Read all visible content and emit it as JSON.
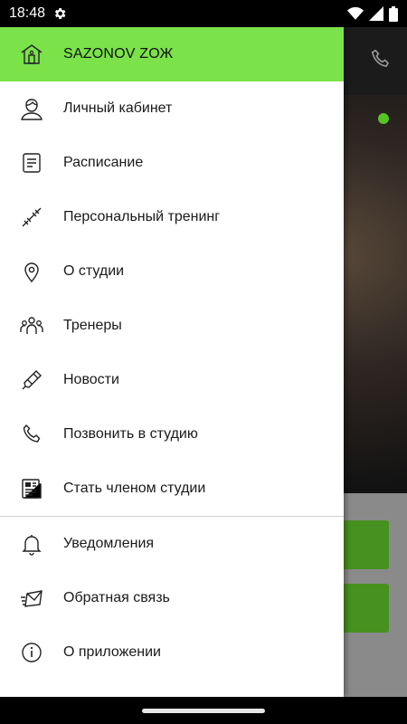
{
  "status_bar": {
    "time": "18:48"
  },
  "drawer": {
    "title": "SAZONOV ZОЖ",
    "header_color": "#7be24a",
    "items_top": [
      {
        "label": "Личный кабинет",
        "icon": "user-icon"
      },
      {
        "label": "Расписание",
        "icon": "schedule-icon"
      },
      {
        "label": "Персональный тренинг",
        "icon": "dumbbell-icon"
      },
      {
        "label": "О студии",
        "icon": "location-pin-icon"
      },
      {
        "label": "Тренеры",
        "icon": "trainers-icon"
      },
      {
        "label": "Новости",
        "icon": "news-icon"
      },
      {
        "label": "Позвонить в студию",
        "icon": "phone-icon"
      },
      {
        "label": "Стать членом студии",
        "icon": "membership-icon"
      }
    ],
    "items_bottom": [
      {
        "label": "Уведомления",
        "icon": "bell-icon"
      },
      {
        "label": "Обратная связь",
        "icon": "feedback-mail-icon"
      },
      {
        "label": "О приложении",
        "icon": "info-icon"
      }
    ]
  },
  "background": {
    "accent": "#58c322",
    "button_color": "#46911f"
  }
}
